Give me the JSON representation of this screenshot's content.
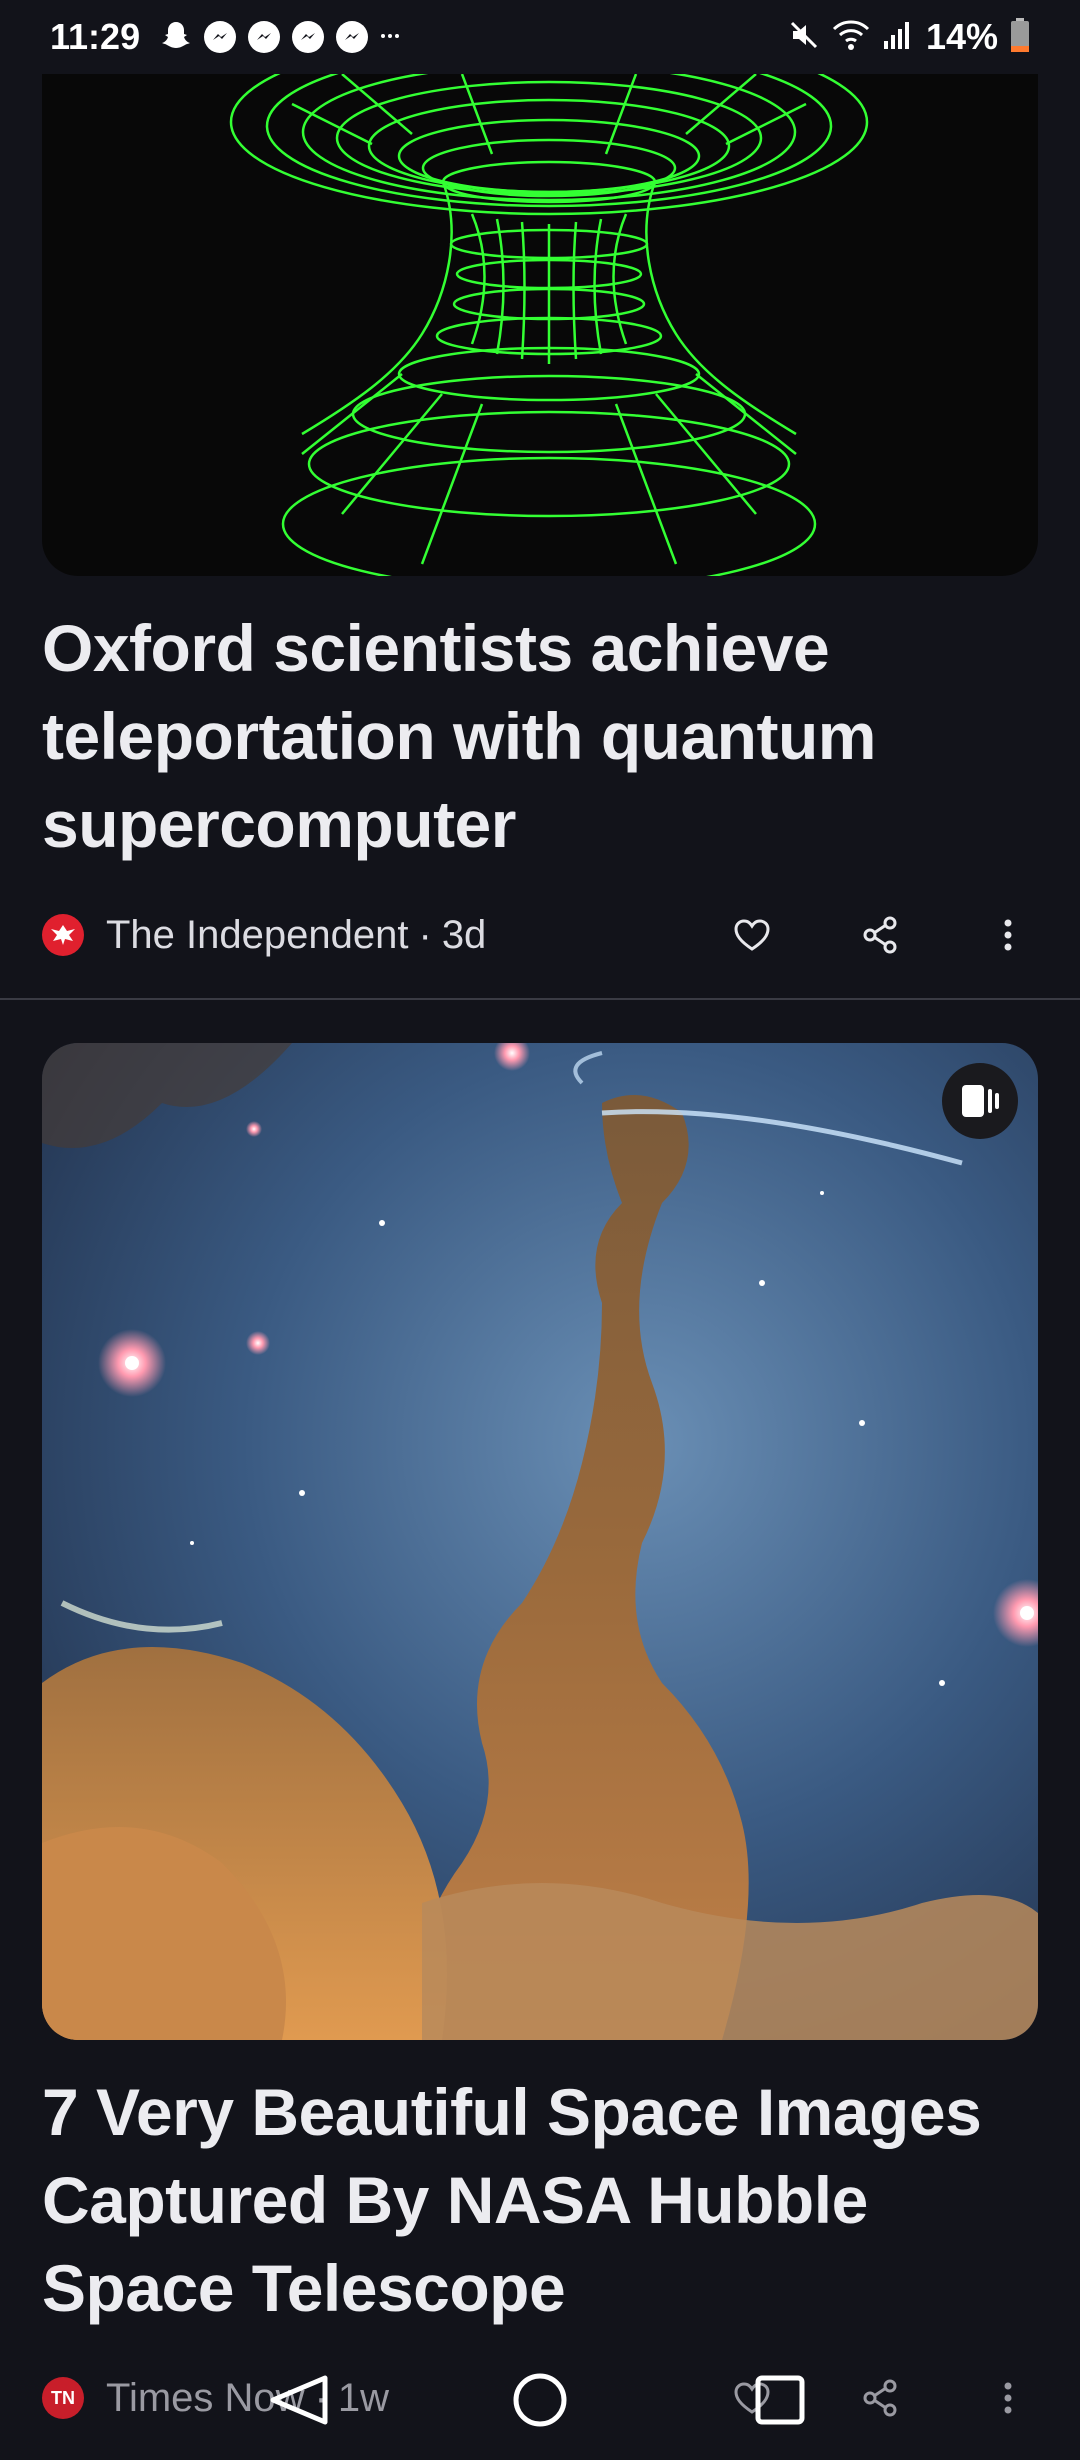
{
  "status_bar": {
    "time": "11:29",
    "battery": "14%",
    "icons": [
      "snapchat-icon",
      "messenger-icon",
      "messenger-icon",
      "messenger-icon",
      "messenger-icon",
      "more-dots-icon",
      "mute-icon",
      "wifi-icon",
      "signal-icon",
      "battery-icon"
    ]
  },
  "articles": [
    {
      "headline": "Oxford scientists achieve teleportation with quantum supercomputer",
      "source": "The Independent",
      "separator": "·",
      "age": "3d",
      "logo_color": "#e0202e",
      "image": "wormhole-grid-image"
    },
    {
      "headline": "7 Very Beautiful Space Images Captured By NASA Hubble Space Telescope",
      "source": "Times Now",
      "separator": "·",
      "age": "1w",
      "logo_text": "TN",
      "logo_color": "#c81e2a",
      "image": "nebula-image"
    }
  ],
  "colors": {
    "background": "#12131a",
    "text": "#ececf0",
    "accent_green": "#33ff33"
  },
  "nav_bar": {
    "buttons": [
      "back-icon",
      "home-icon",
      "recents-icon"
    ]
  }
}
